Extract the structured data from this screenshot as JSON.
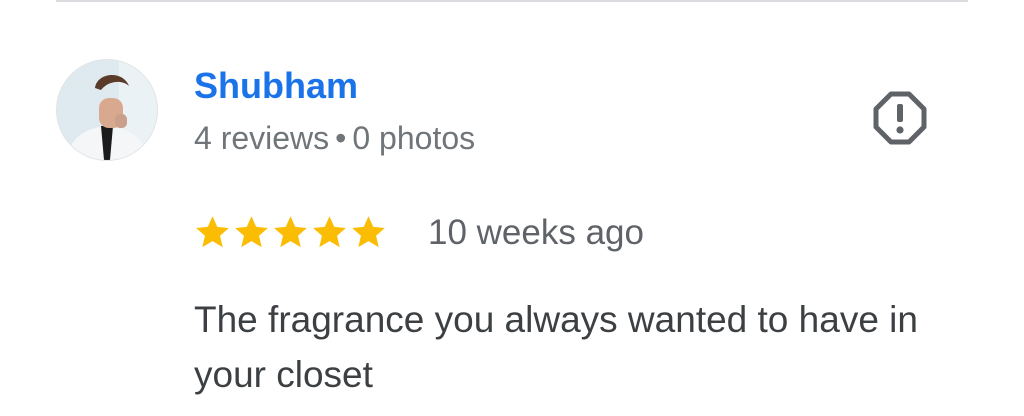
{
  "review": {
    "author_name": "Shubham",
    "reviews_count": "4 reviews",
    "separator": "•",
    "photos_count": "0 photos",
    "rating": 5,
    "rating_max": 5,
    "time_ago": "10 weeks ago",
    "text": "The fragrance you always wanted to have in your closet"
  },
  "icons": {
    "report": "report-octagon-icon",
    "star": "star-icon"
  },
  "colors": {
    "name": "#1a73e8",
    "meta": "#70757a",
    "star": "#fbbc04",
    "text": "#3c4043",
    "divider": "#dadce0"
  }
}
